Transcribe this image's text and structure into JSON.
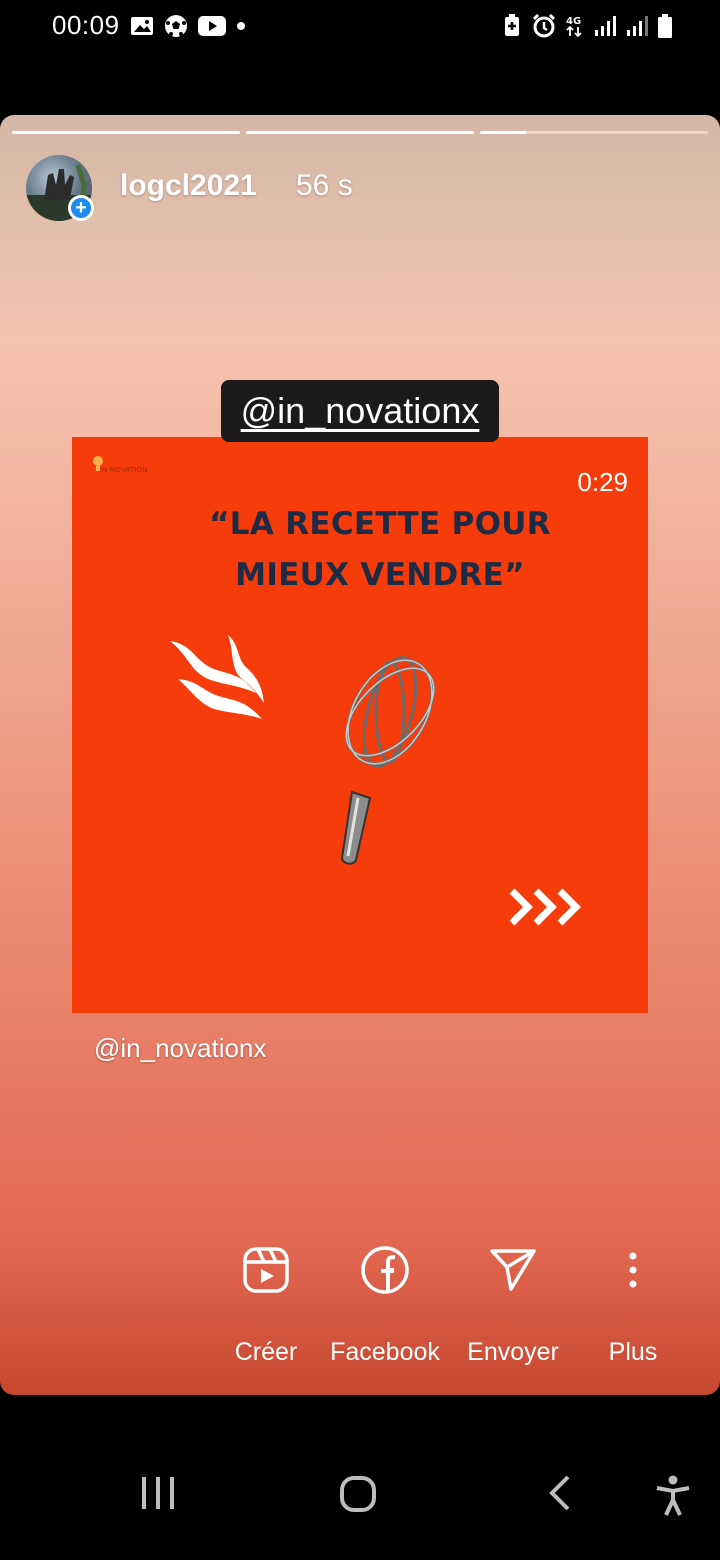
{
  "status_bar": {
    "time": "00:09",
    "left_icons": [
      "gallery-icon",
      "soccer-ball-icon",
      "youtube-icon",
      "dot-icon"
    ],
    "right_icons": [
      "battery-saver-icon",
      "alarm-icon",
      "4g-icon",
      "signal-icon",
      "signal-icon",
      "battery-icon"
    ],
    "network": "4G"
  },
  "story": {
    "progress": [
      1.0,
      1.0,
      0.2
    ],
    "username": "logcl2021",
    "time_ago": "56 s",
    "mention_sticker": "@in_novationx",
    "caption_mention": "@in_novationx",
    "post": {
      "logo_text": "IN NOVATION",
      "video_time": "0:29",
      "headline_line1": "“LA RECETTE POUR",
      "headline_line2": "MIEUX VENDRE”"
    },
    "actions": [
      {
        "label": "Créer",
        "icon": "reels-icon"
      },
      {
        "label": "Facebook",
        "icon": "facebook-icon"
      },
      {
        "label": "Envoyer",
        "icon": "send-icon"
      },
      {
        "label": "Plus",
        "icon": "more-vertical-icon"
      }
    ]
  },
  "nav_bar": {
    "buttons": [
      "recent-apps-icon",
      "home-icon",
      "back-icon",
      "accessibility-icon"
    ]
  },
  "colors": {
    "post_background": "#f63c0b",
    "headline": "#1e2b45",
    "avatar_badge": "#1d8bf0"
  }
}
